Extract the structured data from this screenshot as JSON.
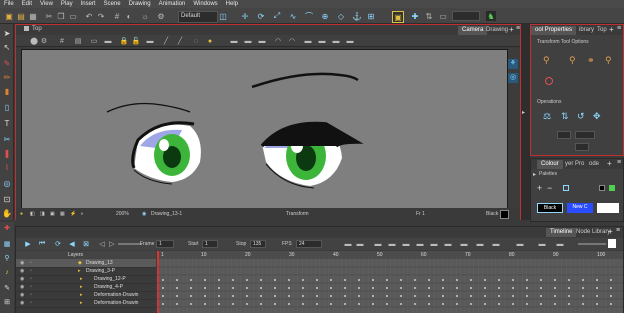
{
  "menu": [
    "File",
    "Edit",
    "View",
    "Play",
    "Insert",
    "Scene",
    "Drawing",
    "Animation",
    "Windows",
    "Help"
  ],
  "toolbar": {
    "preset": "Default"
  },
  "camera_panel": {
    "tabs": [
      "Camera",
      "Drawing"
    ],
    "title": "Top",
    "status": {
      "zoom": "200%",
      "drawing": "Drawing_13-1",
      "mode": "Transform",
      "frame": "Fr 1",
      "color": "Black"
    }
  },
  "tool_properties": {
    "tabs": [
      "ool Properties",
      "ibrary",
      "Top"
    ],
    "title": "Transform Tool Options",
    "operations_label": "Operations"
  },
  "palette_panel": {
    "tabs": [
      "Colour",
      "yer Pro",
      "ode"
    ],
    "palettes_label": "Palettes",
    "swatches": [
      {
        "name": "Black",
        "color": "#000000"
      },
      {
        "name": "New C",
        "color": "#2a4cff"
      },
      {
        "name": "",
        "color": "#ffffff"
      }
    ]
  },
  "timeline": {
    "tabs": [
      "Timeline",
      "Node Library"
    ],
    "frame_label": "Frame",
    "frame_value": "1",
    "start_label": "Start",
    "start_value": "1",
    "stop_label": "Stop",
    "stop_value": "135",
    "fps_label": "FPS",
    "fps_value": "24",
    "layers_header": "Layers",
    "layers": [
      {
        "name": "Drawing_13"
      },
      {
        "name": "Drawing_3-P"
      },
      {
        "name": "Drawing_12-P"
      },
      {
        "name": "Drawing_4-P"
      },
      {
        "name": "Deformation-Drawin"
      },
      {
        "name": "Deformation-Drawin"
      }
    ],
    "ruler_marks": [
      "1",
      "10",
      "20",
      "30",
      "40",
      "50",
      "60",
      "70",
      "80",
      "90",
      "100"
    ]
  },
  "colors": {
    "accent": "#c03030",
    "icon": "#8fd8ff",
    "stage": "#7f7f7f"
  }
}
